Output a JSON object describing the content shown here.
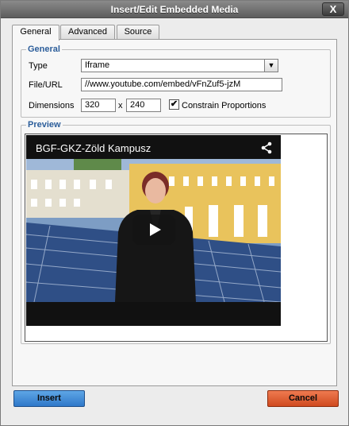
{
  "window": {
    "title": "Insert/Edit Embedded Media",
    "close_label": "X"
  },
  "tabs": [
    {
      "label": "General",
      "active": true
    },
    {
      "label": "Advanced",
      "active": false
    },
    {
      "label": "Source",
      "active": false
    }
  ],
  "general": {
    "legend": "General",
    "type_label": "Type",
    "type_value": "Iframe",
    "file_label": "File/URL",
    "file_value": "//www.youtube.com/embed/vFnZuf5-jzM",
    "dimensions_label": "Dimensions",
    "width_value": "320",
    "times": "x",
    "height_value": "240",
    "constrain_label": "Constrain Proportions",
    "constrain_checked": true,
    "check_mark": "✔"
  },
  "preview": {
    "legend": "Preview",
    "video_title": "BGF-GKZ-Zöld Kampusz"
  },
  "buttons": {
    "insert": "Insert",
    "cancel": "Cancel"
  }
}
